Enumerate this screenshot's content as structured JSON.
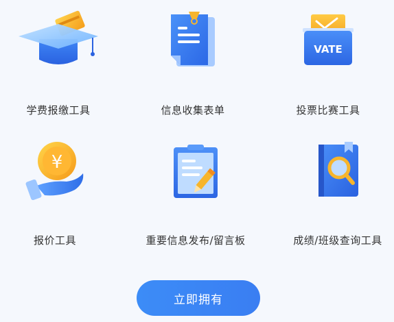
{
  "tools": [
    {
      "label": "学费报缴工具",
      "icon": "graduation-cap-card-icon"
    },
    {
      "label": "信息收集表单",
      "icon": "form-document-icon"
    },
    {
      "label": "投票比赛工具",
      "icon": "vote-box-icon",
      "icon_text": "VATE"
    },
    {
      "label": "报价工具",
      "icon": "coin-hand-icon",
      "icon_text": "¥"
    },
    {
      "label": "重要信息发布/留言板",
      "icon": "clipboard-pencil-icon"
    },
    {
      "label": "成绩/班级查询工具",
      "icon": "book-magnifier-icon"
    }
  ],
  "cta": {
    "label": "立即拥有"
  },
  "colors": {
    "primary": "#3a86f5",
    "accent": "#f7b52c",
    "background": "#f5f8fd",
    "text": "#333333"
  }
}
